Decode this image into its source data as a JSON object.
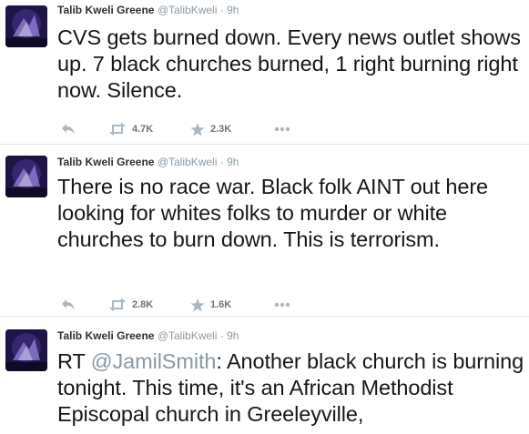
{
  "tweets": [
    {
      "name": "Talib Kweli Greene",
      "handle": "@TalibKweli",
      "dot": "·",
      "time": "9h",
      "text": "CVS gets burned down. Every news outlet shows up. 7 black churches burned, 1 right burning right now. Silence.",
      "retweets": "4.7K",
      "favorites": "2.3K"
    },
    {
      "name": "Talib Kweli Greene",
      "handle": "@TalibKweli",
      "dot": "·",
      "time": "9h",
      "text": "There is no race war. Black folk AINT out here looking for whites folks to murder or white churches to burn down. This is terrorism.",
      "retweets": "2.8K",
      "favorites": "1.6K"
    },
    {
      "name": "Talib Kweli Greene",
      "handle": "@TalibKweli",
      "dot": "·",
      "time": "9h",
      "text_prefix": "RT ",
      "mention": "@JamilSmith",
      "text": ": Another black church is burning tonight. This time, it's an African Methodist Episcopal church in Greeleyville,"
    }
  ],
  "icons": {
    "reply": "reply-icon",
    "retweet": "retweet-icon",
    "favorite": "star-icon",
    "more": "more-dots-icon"
  },
  "colors": {
    "text": "#14171a",
    "meta": "#8899a6",
    "action": "#aab8c2",
    "divider": "#e1e8ed"
  }
}
